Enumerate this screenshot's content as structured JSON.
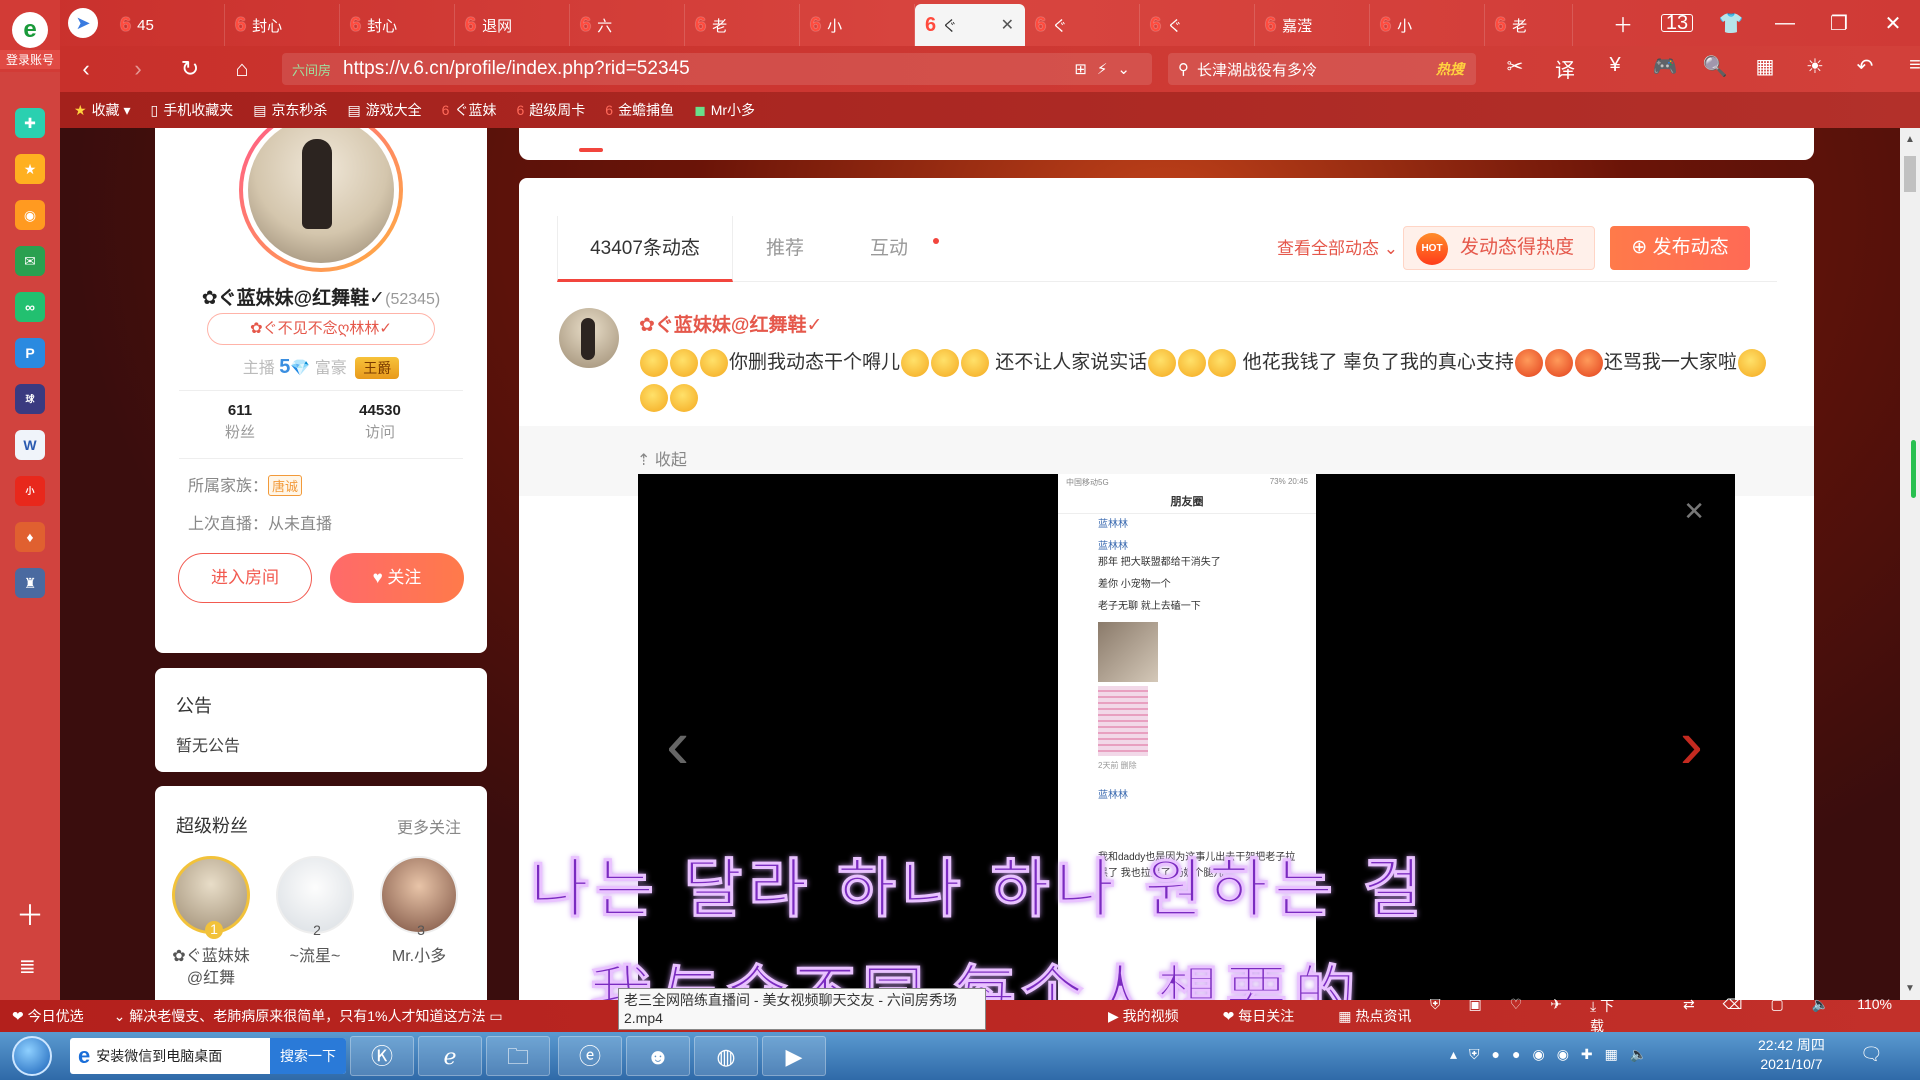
{
  "browser": {
    "login_label": "登录账号",
    "tabs": [
      {
        "label": "45"
      },
      {
        "label": "封心"
      },
      {
        "label": "封心"
      },
      {
        "label": "退网"
      },
      {
        "label": "六"
      },
      {
        "label": "老"
      },
      {
        "label": "小"
      },
      {
        "label": "ぐ"
      },
      {
        "label": "ぐ"
      },
      {
        "label": "ぐ"
      },
      {
        "label": "嘉滢"
      },
      {
        "label": "小"
      },
      {
        "label": "老"
      }
    ],
    "tab_count": "13",
    "url_secure_label": "六间房",
    "url": "https://v.6.cn/profile/index.php?rid=52345",
    "search_query": "长津湖战役有多冷",
    "search_hot_label": "热搜",
    "zoom": "110%",
    "bookmarks": [
      "收藏",
      "手机收藏夹",
      "京东秒杀",
      "游戏大全",
      "ぐ蓝妹",
      "超级周卡",
      "金蟾捕鱼",
      "Mr小多"
    ]
  },
  "profile": {
    "name": "✿ぐ蓝妹妹@红舞鞋✓",
    "rid": "(52345)",
    "signature": "✿ぐ不见不念ღ林林✓",
    "anchor_label": "主播",
    "anchor_level": "5",
    "rich_label": "富豪",
    "rich_badge": "王爵",
    "fans_count": "611",
    "fans_label": "粉丝",
    "visits_count": "44530",
    "visits_label": "访问",
    "family_label": "所属家族：",
    "family_badge": "唐诚",
    "last_live": "上次直播：从未直播",
    "enter_room": "进入房间",
    "follow": "关注"
  },
  "notice": {
    "title": "公告",
    "text": "暂无公告"
  },
  "super_fans": {
    "title": "超级粉丝",
    "more": "更多关注",
    "fans": [
      {
        "rank": "1",
        "name": "✿ぐ蓝妹妹@红舞"
      },
      {
        "rank": "2",
        "name": "~流星~"
      },
      {
        "rank": "3",
        "name": "Mr.小多"
      }
    ]
  },
  "feed": {
    "tabs": [
      {
        "label": "43407条动态"
      },
      {
        "label": "推荐"
      },
      {
        "label": "互动"
      }
    ],
    "view_all": "查看全部动态",
    "hot_button": "发动态得热度",
    "hot_icon": "HOT",
    "post_button": "发布动态",
    "post": {
      "author": "✿ぐ蓝妹妹@红舞鞋✓",
      "text_1": "你删我动态干个嘚儿",
      "text_2": "还不让人家说实话",
      "text_3": "他花我钱了 辜负了我的真心支持",
      "text_4": "还骂我一大家啦",
      "collapse": "收起"
    }
  },
  "screenshot": {
    "status_left": "中国移动5G",
    "status_right": "73% 20:45",
    "title": "朋友圈",
    "lines": [
      {
        "name": "蓝林林",
        "text": ""
      },
      {
        "name": "蓝林林",
        "text": "那年 把大联盟都给干消失了"
      },
      {
        "name": "",
        "text": "差你 小宠物一个"
      },
      {
        "name": "",
        "text": "老子无聊 就上去磕一下"
      },
      {
        "name": "",
        "text": "2天前  删除"
      },
      {
        "name": "蓝林林",
        "text": ""
      },
      {
        "name": "",
        "text": "我和daddy也是因为这事儿出去干架把老子拉黑了 我也拉黑了 奶奶个腿儿"
      }
    ]
  },
  "subtitles": {
    "korean": "나는 달라 하나 하나 원하는 걸",
    "chinese": "我与众不同 每个人想要的"
  },
  "statusbar": {
    "today": "今日优选",
    "news": "解决老慢支、老肺病原来很简单，只有1%人才知道这方法",
    "tooltip": "老三全网陪练直播间 - 美女视频聊天交友 - 六间房秀场2.mp4",
    "my_video": "我的视频",
    "daily": "每日关注",
    "hot_news": "热点资讯",
    "download": "下载"
  },
  "taskbar": {
    "search_text": "安装微信到电脑桌面",
    "search_button": "搜索一下",
    "time": "22:42 周四",
    "date": "2021/10/7"
  }
}
